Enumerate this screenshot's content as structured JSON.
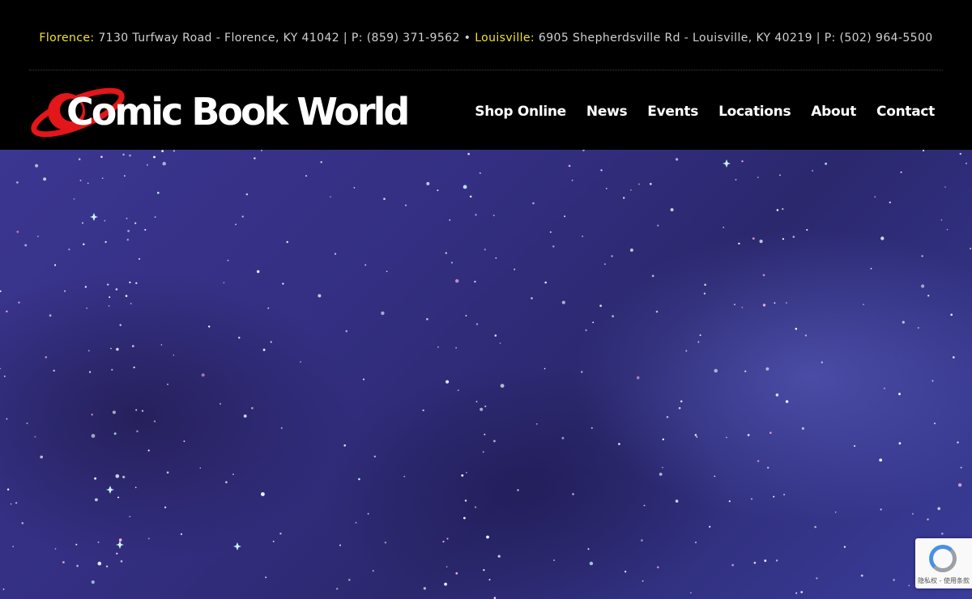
{
  "info_bar": {
    "florence_label": "Florence:",
    "florence_text": "7130 Turfway Road - Florence, KY 41042 | P: (859) 371-9562",
    "separator": "•",
    "louisville_label": "Louisville:",
    "louisville_text": "6905 Shepherdsville Rd - Louisville, KY 40219 | P: (502) 964-5500",
    "city_color": "#f2e12f"
  },
  "logo": {
    "text": "Comic Book World",
    "orbit_color": "#e3161a"
  },
  "nav": {
    "items": [
      "Shop Online",
      "News",
      "Events",
      "Locations",
      "About",
      "Contact"
    ]
  },
  "recaptcha": {
    "text": "隐私权 - 使用条款",
    "icon": "recaptcha-icon"
  }
}
